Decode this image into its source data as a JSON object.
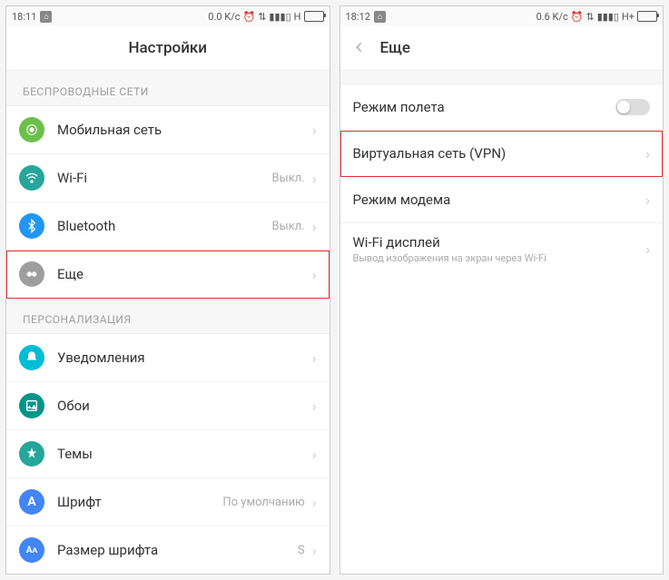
{
  "left": {
    "status": {
      "time": "18:11",
      "speed": "0.0 K/c",
      "net": "H"
    },
    "title": "Настройки",
    "section1": "БЕСПРОВОДНЫЕ СЕТИ",
    "items1": [
      {
        "label": "Мобильная сеть",
        "value": ""
      },
      {
        "label": "Wi-Fi",
        "value": "Выкл."
      },
      {
        "label": "Bluetooth",
        "value": "Выкл."
      },
      {
        "label": "Еще",
        "value": ""
      }
    ],
    "section2": "ПЕРСОНАЛИЗАЦИЯ",
    "items2": [
      {
        "label": "Уведомления",
        "value": ""
      },
      {
        "label": "Обои",
        "value": ""
      },
      {
        "label": "Темы",
        "value": ""
      },
      {
        "label": "Шрифт",
        "value": "По умолчанию"
      },
      {
        "label": "Размер шрифта",
        "value": "S"
      }
    ]
  },
  "right": {
    "status": {
      "time": "18:12",
      "speed": "0.6 K/c",
      "net": "H+"
    },
    "title": "Еще",
    "items": [
      {
        "label": "Режим полета",
        "sub": "",
        "toggle": true
      },
      {
        "label": "Виртуальная сеть (VPN)",
        "sub": "",
        "highlight": true
      },
      {
        "label": "Режим модема",
        "sub": ""
      },
      {
        "label": "Wi-Fi дисплей",
        "sub": "Вывод изображения на экран через Wi-Fi"
      }
    ]
  }
}
